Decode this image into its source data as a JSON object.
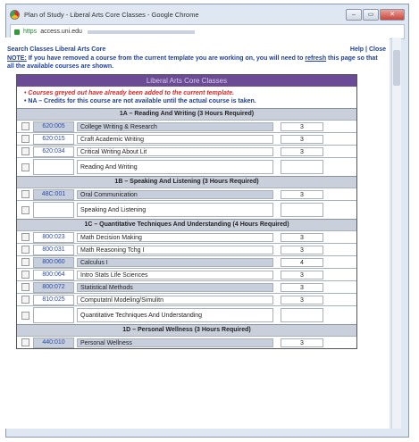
{
  "window": {
    "title": "Plan of Study - Liberal Arts Core Classes - Google Chrome",
    "buttons": [
      "–",
      "▭",
      "✕"
    ]
  },
  "address": {
    "scheme": "https",
    "host": "access.uni.edu"
  },
  "header": {
    "left": "Search Classes  Liberal Arts Core",
    "help": "Help",
    "separator": "|",
    "close": "Close"
  },
  "note": {
    "label": "NOTE:",
    "text_a": " If you have removed a course from the current template you are working on, you will need to ",
    "refresh": "refresh",
    "text_b": " this page so that all the available courses are shown."
  },
  "panel": {
    "title": "Liberal Arts Core Classes",
    "legend_red": "Courses greyed out have already been added to the current template.",
    "legend_blue": "NA – Credits for this course are not available until the actual course is taken."
  },
  "categories": [
    {
      "title": "1A – Reading And Writing (3 Hours Required)",
      "rows": [
        {
          "code": "620:005",
          "name": "College Writing & Research",
          "hours": "3",
          "greyed": true,
          "tall": false
        },
        {
          "code": "620:015",
          "name": "Craft Academic Writing",
          "hours": "3",
          "greyed": false,
          "tall": false
        },
        {
          "code": "620:034",
          "name": "Critical Writing About Lit",
          "hours": "3",
          "greyed": false,
          "tall": false
        },
        {
          "code": "",
          "name": "Reading And Writing",
          "hours": "",
          "greyed": false,
          "tall": true
        }
      ]
    },
    {
      "title": "1B – Speaking And Listening (3 Hours Required)",
      "rows": [
        {
          "code": "48C:001",
          "name": "Oral Communication",
          "hours": "3",
          "greyed": true,
          "tall": false
        },
        {
          "code": "",
          "name": "Speaking And Listening",
          "hours": "",
          "greyed": false,
          "tall": true
        }
      ]
    },
    {
      "title": "1C – Quantitative Techniques And Understanding (4 Hours Required)",
      "rows": [
        {
          "code": "800:023",
          "name": "Math Decision Making",
          "hours": "3",
          "greyed": false,
          "tall": false
        },
        {
          "code": "800:031",
          "name": "Math Reasoning Tchg I",
          "hours": "3",
          "greyed": false,
          "tall": false
        },
        {
          "code": "800:060",
          "name": "Calculus I",
          "hours": "4",
          "greyed": true,
          "tall": false
        },
        {
          "code": "800:064",
          "name": "Intro Stats Life Sciences",
          "hours": "3",
          "greyed": false,
          "tall": false
        },
        {
          "code": "800:072",
          "name": "Statistical Methods",
          "hours": "3",
          "greyed": true,
          "tall": false
        },
        {
          "code": "810:025",
          "name": "Computatnl Modeling/Simulitn",
          "hours": "3",
          "greyed": false,
          "tall": false
        },
        {
          "code": "",
          "name": "Quantitative Techniques And Understanding",
          "hours": "",
          "greyed": false,
          "tall": true
        }
      ]
    },
    {
      "title": "1D – Personal Wellness (3 Hours Required)",
      "rows": [
        {
          "code": "440:010",
          "name": "Personal Wellness",
          "hours": "3",
          "greyed": true,
          "tall": false
        }
      ]
    }
  ],
  "colors": {
    "accent": "#6b4a96",
    "link": "#1f3f99",
    "alert": "#d12b2b",
    "greyed_row": "#c7cedc"
  }
}
